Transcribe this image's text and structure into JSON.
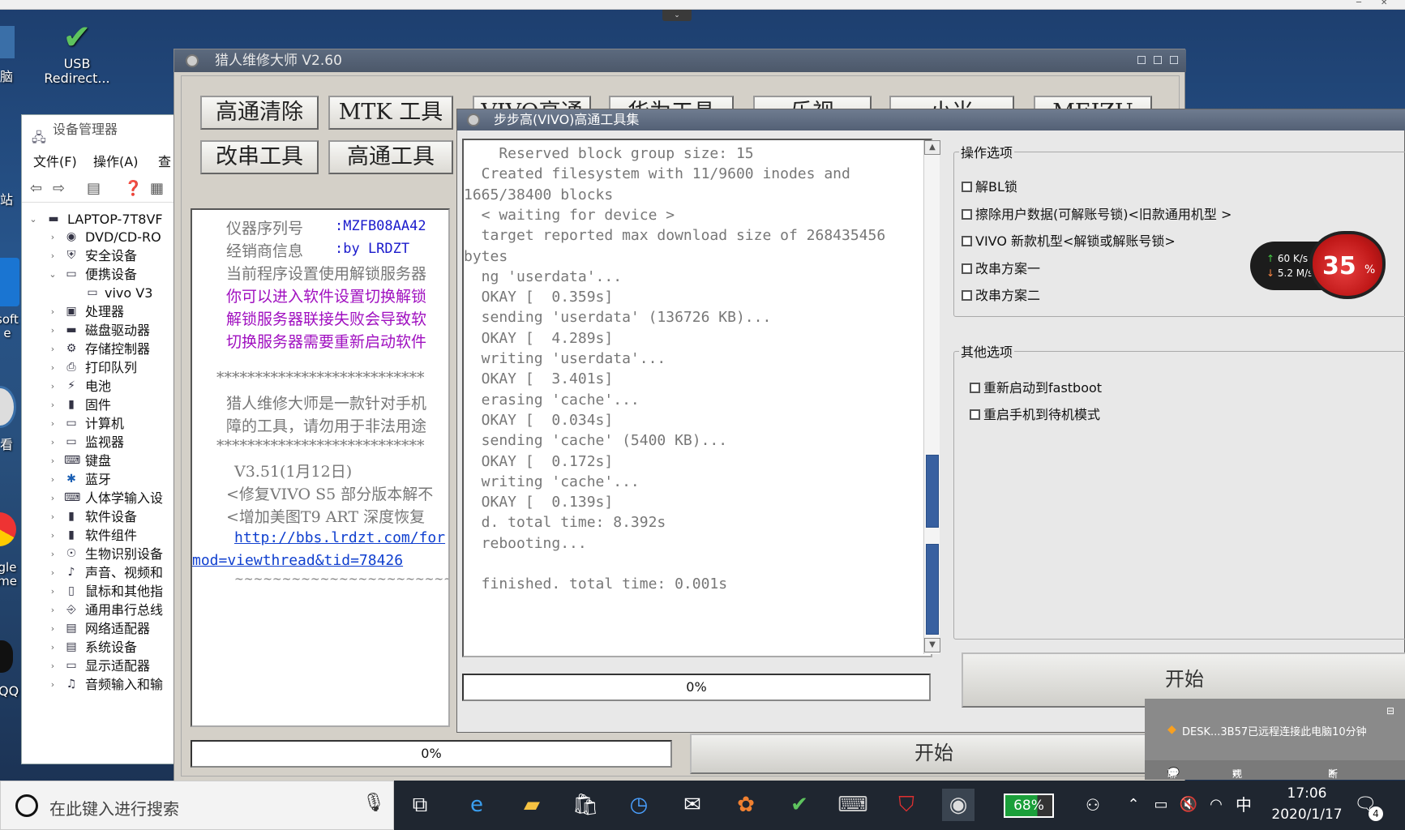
{
  "desktop": {
    "icons": [
      {
        "label": "USB\nRedirect..."
      },
      {
        "label": "脑"
      },
      {
        "label": "站"
      },
      {
        "label": "soft\ne"
      },
      {
        "label": "看"
      },
      {
        "label": "gle\nme"
      },
      {
        "label": "QQ"
      }
    ]
  },
  "device_manager": {
    "title": "设备管理器",
    "menu": [
      "文件(F)",
      "操作(A)",
      "查"
    ],
    "root": "LAPTOP-7T8VF",
    "items": [
      "DVD/CD-RO",
      "安全设备",
      "便携设备",
      "vivo V3",
      "处理器",
      "磁盘驱动器",
      "存储控制器",
      "打印队列",
      "电池",
      "固件",
      "计算机",
      "监视器",
      "键盘",
      "蓝牙",
      "人体学输入设",
      "软件设备",
      "软件组件",
      "生物识别设备",
      "声音、视频和",
      "鼠标和其他指",
      "通用串行总线",
      "网络适配器",
      "系统设备",
      "显示适配器",
      "音频输入和输"
    ]
  },
  "hunter": {
    "title": "猎人维修大师 V2.60",
    "buttons_row1": [
      "高通清除",
      "MTK 工具",
      "VIVO高通",
      "华为工具",
      "乐视",
      "小米",
      "MEIZU"
    ],
    "buttons_row2": [
      "改串工具",
      "高通工具"
    ],
    "info": {
      "serial_label": "仪器序列号",
      "serial_value": ":MZFB08AA42",
      "dealer_label": "经销商信息",
      "dealer_value": ":by LRDZT",
      "line_setting": "当前程序设置使用解锁服务器",
      "pink1": "你可以进入软件设置切换解锁",
      "pink2": "解锁服务器联接失败会导致软",
      "pink3": "切换服务器需要重新启动软件",
      "stars": "***************************",
      "desc1": "猎人维修大师是一款针对手机",
      "desc2": "障的工具，请勿用于非法用途",
      "stars2": "***************************",
      "version": "V3.51(1月12日)",
      "fix1": "<修复VIVO S5 部分版本解不",
      "fix2": "<增加美图T9 ART 深度恢复",
      "link1": "http://bbs.lrdzt.com/for",
      "link2": "mod=viewthread&tid=78426",
      "tilde": "~~~~~~~~~~~~~~~~~~~~~~~~~~"
    },
    "progress": "0%",
    "start": "开始"
  },
  "vivo": {
    "title": "步步高(VIVO)高通工具集",
    "log": [
      "    Reserved block group size: 15",
      "  Created filesystem with 11/9600 inodes and",
      "1665/38400 blocks",
      "  < waiting for device >",
      "  target reported max download size of 268435456",
      "bytes",
      "  ng 'userdata'...",
      "  OKAY [  0.359s]",
      "  sending 'userdata' (136726 KB)...",
      "  OKAY [  4.289s]",
      "  writing 'userdata'...",
      "  OKAY [  3.401s]",
      "  erasing 'cache'...",
      "  OKAY [  0.034s]",
      "  sending 'cache' (5400 KB)...",
      "  OKAY [  0.172s]",
      "  writing 'cache'...",
      "  OKAY [  0.139s]",
      "  d. total time: 8.392s",
      "  rebooting...",
      "",
      "  finished. total time: 0.001s"
    ],
    "operations_legend": "操作选项",
    "operations": [
      "解BL锁",
      "擦除用户数据(可解账号锁)<旧款通用机型 >",
      "VIVO 新款机型<解锁或解账号锁>",
      "改串方案一",
      "改串方案二"
    ],
    "other_legend": "其他选项",
    "other": [
      "重新启动到fastboot",
      "重启手机到待机模式"
    ],
    "progress": "0%",
    "start": "开始"
  },
  "speed_widget": {
    "up": "60 K/s",
    "down": "5.2 M/s",
    "percent": "35",
    "unit": "%"
  },
  "notification": {
    "message": "DESK...3B57已远程连接此电脑10分钟",
    "actions": [
      "聊天",
      "观看模式",
      "断开连接"
    ]
  },
  "taskbar": {
    "search_placeholder": "在此键入进行搜索",
    "battery": "68%",
    "time": "17:06",
    "date": "2020/1/17",
    "ime": "中",
    "notif_count": "4"
  }
}
